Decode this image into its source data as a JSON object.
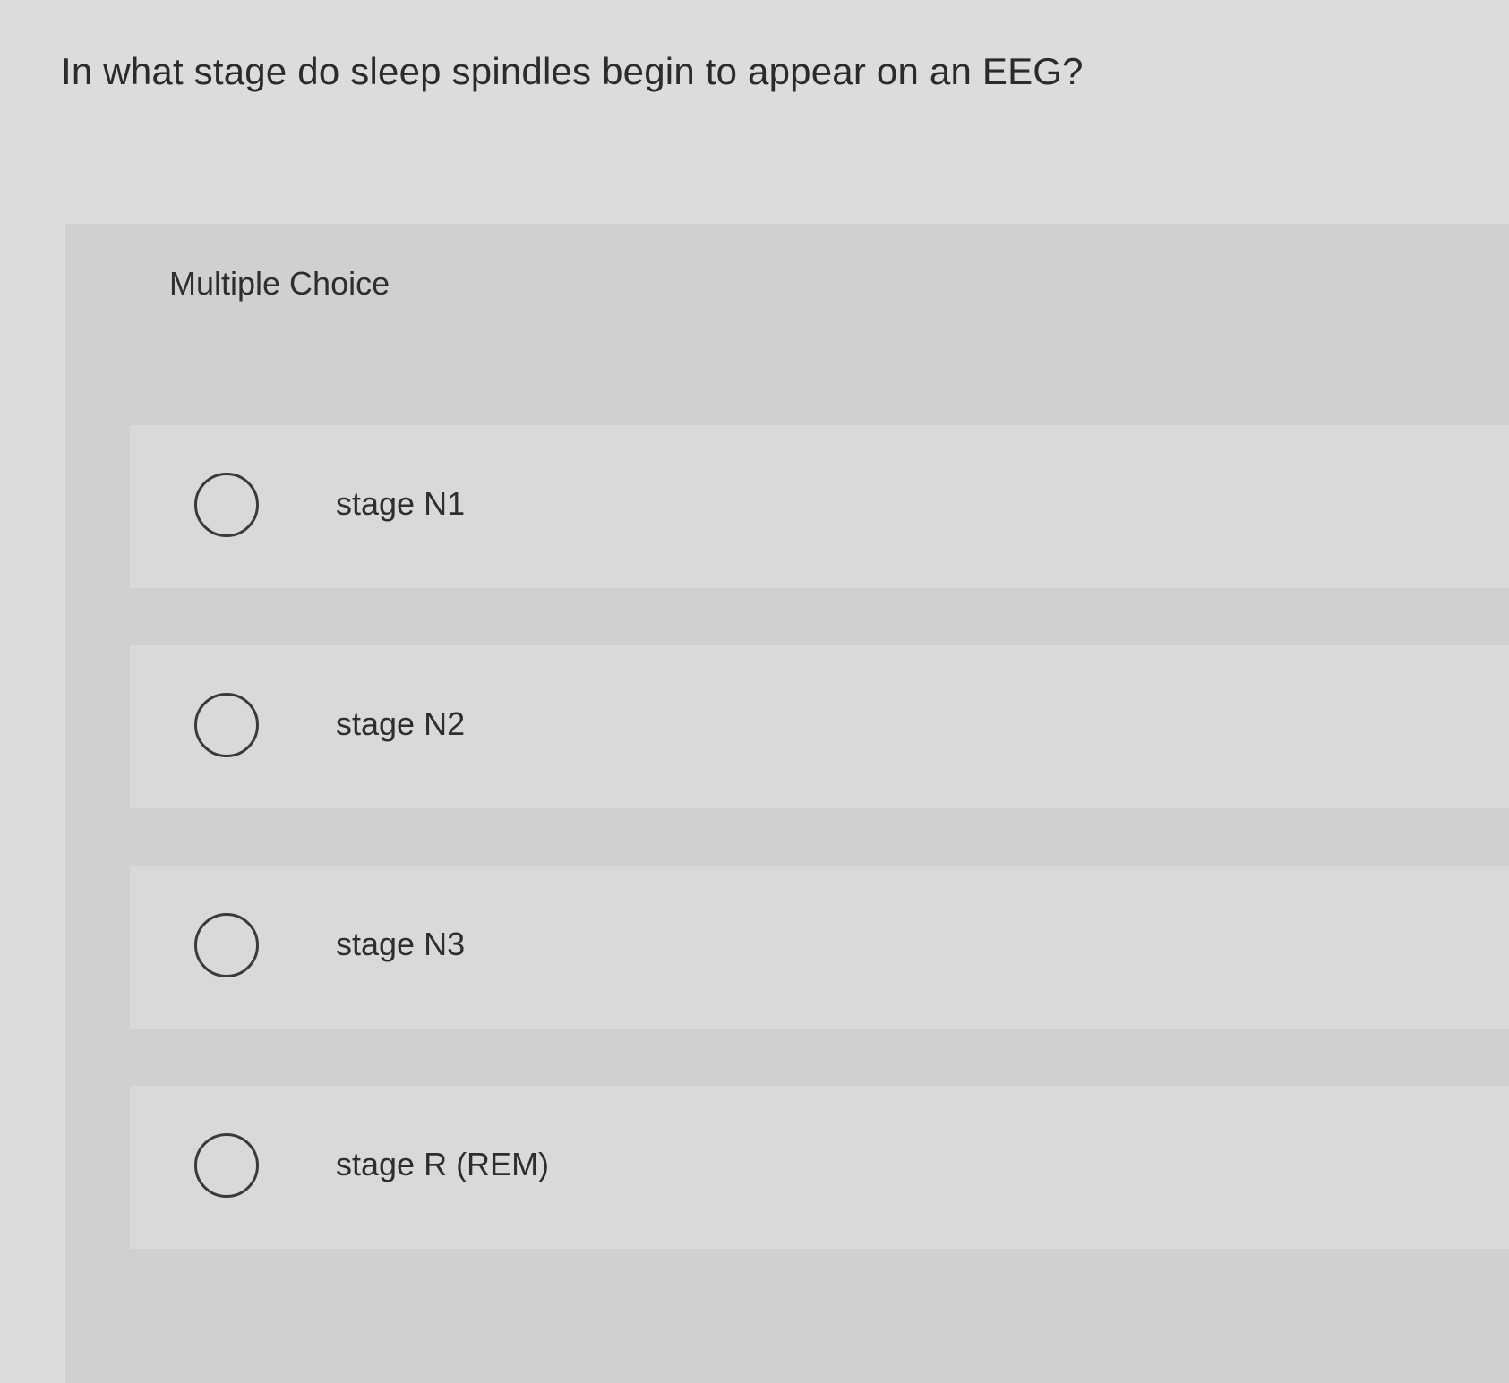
{
  "question": {
    "text": "In what stage do sleep spindles begin to appear on an EEG?"
  },
  "answer_panel": {
    "type_label": "Multiple Choice",
    "choices": [
      {
        "label": "stage N1",
        "selected": false
      },
      {
        "label": "stage N2",
        "selected": false
      },
      {
        "label": "stage N3",
        "selected": false
      },
      {
        "label": "stage R (REM)",
        "selected": false
      }
    ]
  }
}
